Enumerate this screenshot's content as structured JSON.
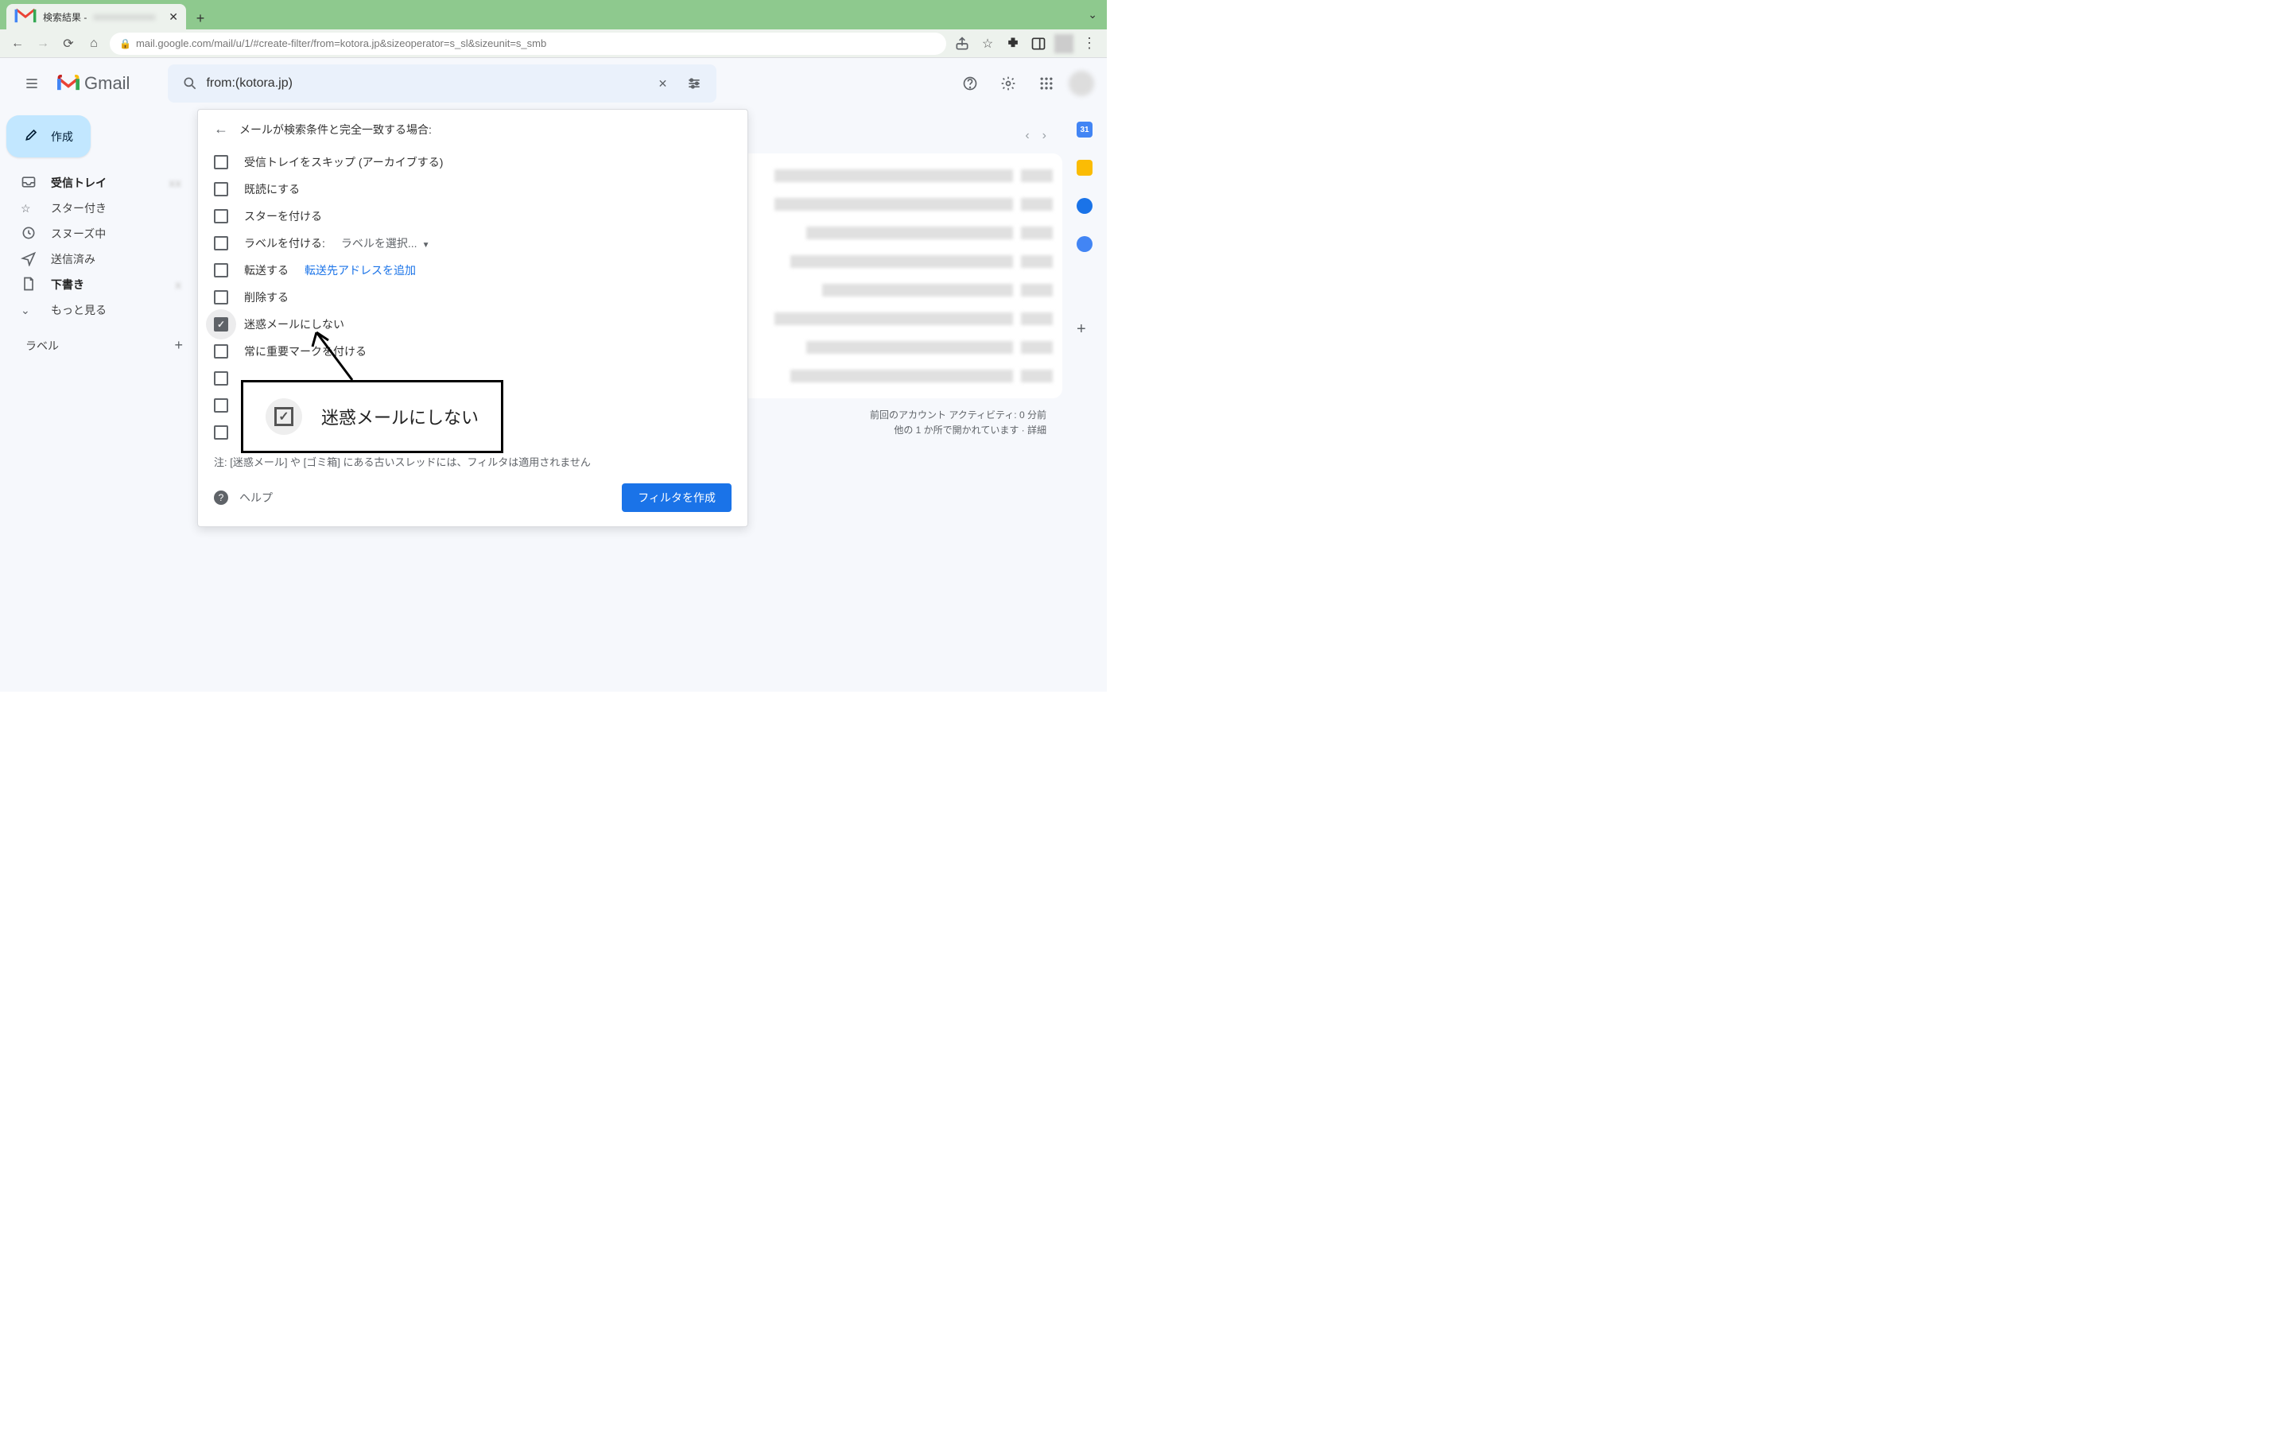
{
  "browser": {
    "tab_title": "検索結果 -",
    "url": "mail.google.com/mail/u/1/#create-filter/from=kotora.jp&sizeoperator=s_sl&sizeunit=s_smb"
  },
  "gmail": {
    "brand": "Gmail",
    "search_value": "from:(kotora.jp)"
  },
  "sidebar": {
    "compose": "作成",
    "items": [
      {
        "icon": "inbox",
        "label": "受信トレイ",
        "bold": true,
        "count": true
      },
      {
        "icon": "star",
        "label": "スター付き"
      },
      {
        "icon": "clock",
        "label": "スヌーズ中"
      },
      {
        "icon": "send",
        "label": "送信済み"
      },
      {
        "icon": "draft",
        "label": "下書き",
        "bold": true,
        "count": true
      },
      {
        "icon": "more",
        "label": "もっと見る"
      }
    ],
    "labels_heading": "ラベル"
  },
  "filter": {
    "heading": "メールが検索条件と完全一致する場合:",
    "options": {
      "skip_inbox": "受信トレイをスキップ (アーカイブする)",
      "mark_read": "既読にする",
      "star": "スターを付ける",
      "apply_label_prefix": "ラベルを付ける:",
      "apply_label_select": "ラベルを選択...",
      "forward_prefix": "転送する",
      "forward_link": "転送先アドレスを追加",
      "delete": "削除する",
      "never_spam": "迷惑メールにしない",
      "always_important": "常に重要マークを付ける"
    },
    "note": "注: [迷惑メール] や [ゴミ箱] にある古いスレッドには、フィルタは適用されません",
    "help": "ヘルプ",
    "create_button": "フィルタを作成"
  },
  "callout": {
    "text": "迷惑メールにしない"
  },
  "right_panel": {
    "calendar_day": "31"
  },
  "footer": {
    "activity": "前回のアカウント アクティビティ: 0 分前",
    "details": "他の 1 か所で開かれています · 詳細"
  }
}
